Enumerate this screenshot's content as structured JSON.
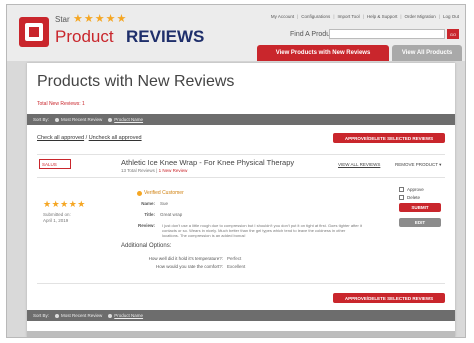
{
  "header": {
    "logo": {
      "star_label": "Star",
      "stars": "★★★★★",
      "product": "Product",
      "reviews": "REVIEWS"
    },
    "top_links": [
      "My Account",
      "Configurations",
      "Import Tool",
      "Help & Support",
      "Order Migration",
      "Log Out"
    ],
    "search": {
      "label": "Find A Product",
      "value": "",
      "button": "GO"
    },
    "tabs": {
      "active": "View Products with New Reviews",
      "inactive": "View All Products"
    }
  },
  "main": {
    "title": "Products with New Reviews",
    "total_new": "Total New Reviews: 1",
    "sort_bar": {
      "label": "Sort By:",
      "option": "Most Recent Review",
      "date": "Product Name"
    },
    "check_all": "Check all approved",
    "uncheck_all": "Uncheck all approved",
    "approve_button": "APPROVE/DELETE SELECTED REVIEWS",
    "product": {
      "thumb_label": "SALUS",
      "name": "Athletic Ice Knee Wrap - For Knee Physical Therapy",
      "total_reviews": "13 Total Reviews",
      "new_reviews": "1 New Review",
      "view_all": "VIEW ALL REVIEWS",
      "remove": "REMOVE PRODUCT ▾"
    },
    "review": {
      "stars": "★★★★★",
      "submitted_label": "Submitted on:",
      "submitted_date": "April 1, 2019",
      "verified": "Verified Customer",
      "name_label": "Name:",
      "name_value": "Sue",
      "title_label": "Title:",
      "title_value": "Great wrap",
      "review_label": "Review:",
      "review_text": "I just don't use a little rough due to compression but I shouldn't you don't put it on tight at first. Goes tighter after it contacts or so. Wears in nicely. Much better than the gel types which tend to leave the coldness in other locations. The compression is an added bonus!",
      "additional_title": "Additional Options:",
      "questions": [
        {
          "q": "How well did it hold it's temperature?:",
          "a": "Perfect"
        },
        {
          "q": "How would you rate the comfort?:",
          "a": "Excellent"
        }
      ],
      "approve_label": "Approve",
      "delete_label": "Delete",
      "submit_button": "SUBMIT",
      "edit_button": "EDIT"
    }
  }
}
